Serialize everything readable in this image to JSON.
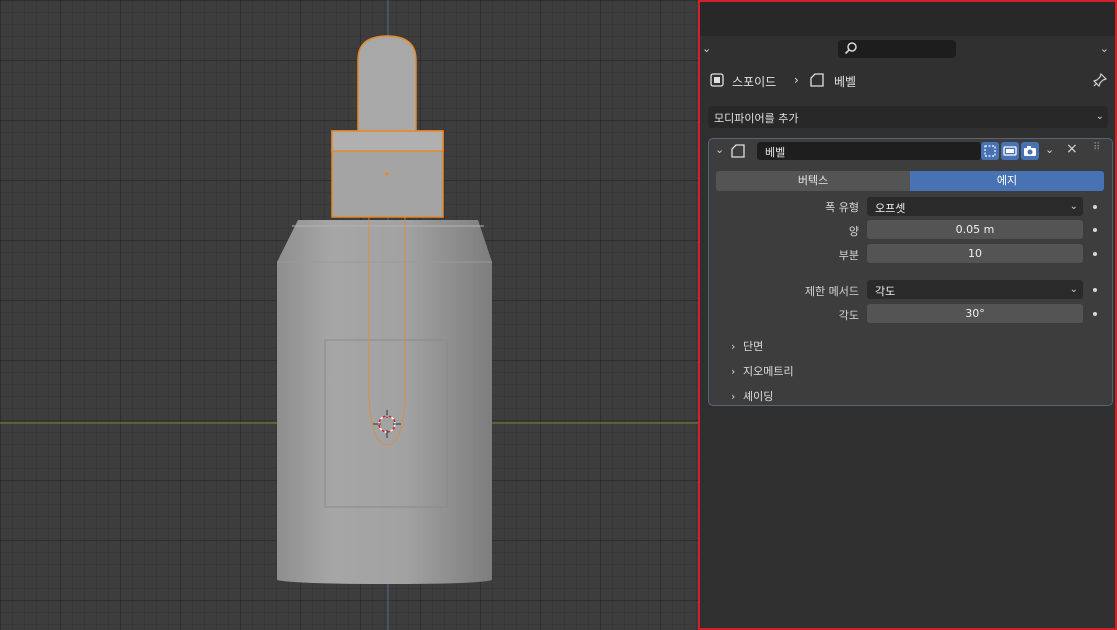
{
  "breadcrumb": {
    "object_name": "스포이드",
    "separator": "›",
    "modifier_name": "베벨"
  },
  "add_modifier": {
    "label": "모디파이어를 추가"
  },
  "modifier": {
    "name": "베벨",
    "affect_options": [
      "버텍스",
      "에지"
    ],
    "affect_selected": "에지",
    "width_type": {
      "label": "폭 유형",
      "value": "오프셋"
    },
    "amount": {
      "label": "양",
      "value": "0.05 m"
    },
    "segments": {
      "label": "부분",
      "value": "10"
    },
    "limit_method": {
      "label": "제한 메서드",
      "value": "각도"
    },
    "angle": {
      "label": "각도",
      "value": "30°"
    },
    "subpanels": [
      "단면",
      "지오메트리",
      "셰이딩"
    ]
  },
  "colors": {
    "accent": "#4772b3",
    "selection_outline": "#e58a2a",
    "panel_highlight_border": "#d0202a"
  },
  "icons": {
    "search": "search-icon",
    "object": "object-icon",
    "modifier": "bevel-modifier-icon",
    "pin": "pin-icon",
    "close": "close-icon"
  }
}
